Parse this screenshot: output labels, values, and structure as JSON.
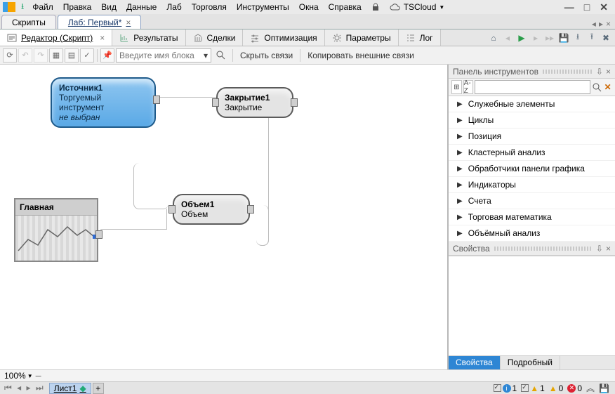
{
  "menu": {
    "items": [
      "Файл",
      "Правка",
      "Вид",
      "Данные",
      "Лаб",
      "Торговля",
      "Инструменты",
      "Окна",
      "Справка"
    ],
    "cloud": "TSCloud"
  },
  "doctabs": {
    "scripts": "Скрипты",
    "lab": "Лаб: Первый*"
  },
  "ribbon": {
    "editor": "Редактор (Скрипт)",
    "results": "Результаты",
    "deals": "Сделки",
    "opt": "Оптимизация",
    "params": "Параметры",
    "log": "Лог"
  },
  "toolbar": {
    "block_placeholder": "Введите имя блока",
    "hide_links": "Скрыть связи",
    "copy_ext": "Копировать внешние связи"
  },
  "canvas": {
    "src": {
      "title": "Источник1",
      "l1": "Торгуемый инструмент",
      "l2": "не выбран"
    },
    "close": {
      "title": "Закрытие1",
      "sub": "Закрытие"
    },
    "vol": {
      "title": "Объем1",
      "sub": "Объем"
    },
    "panel": "Главная"
  },
  "side": {
    "tools": "Панель инструментов",
    "az": "A-Z",
    "cats": [
      "Служебные элементы",
      "Циклы",
      "Позиция",
      "Кластерный анализ",
      "Обработчики панели графика",
      "Индикаторы",
      "Счета",
      "Торговая математика",
      "Объёмный анализ"
    ],
    "props": "Свойства",
    "tab_props": "Свойства",
    "tab_detail": "Подробный"
  },
  "status": {
    "zoom": "100%",
    "sheet": "Лист1",
    "c1": "1",
    "c2": "1",
    "c3": "0",
    "c4": "0"
  }
}
